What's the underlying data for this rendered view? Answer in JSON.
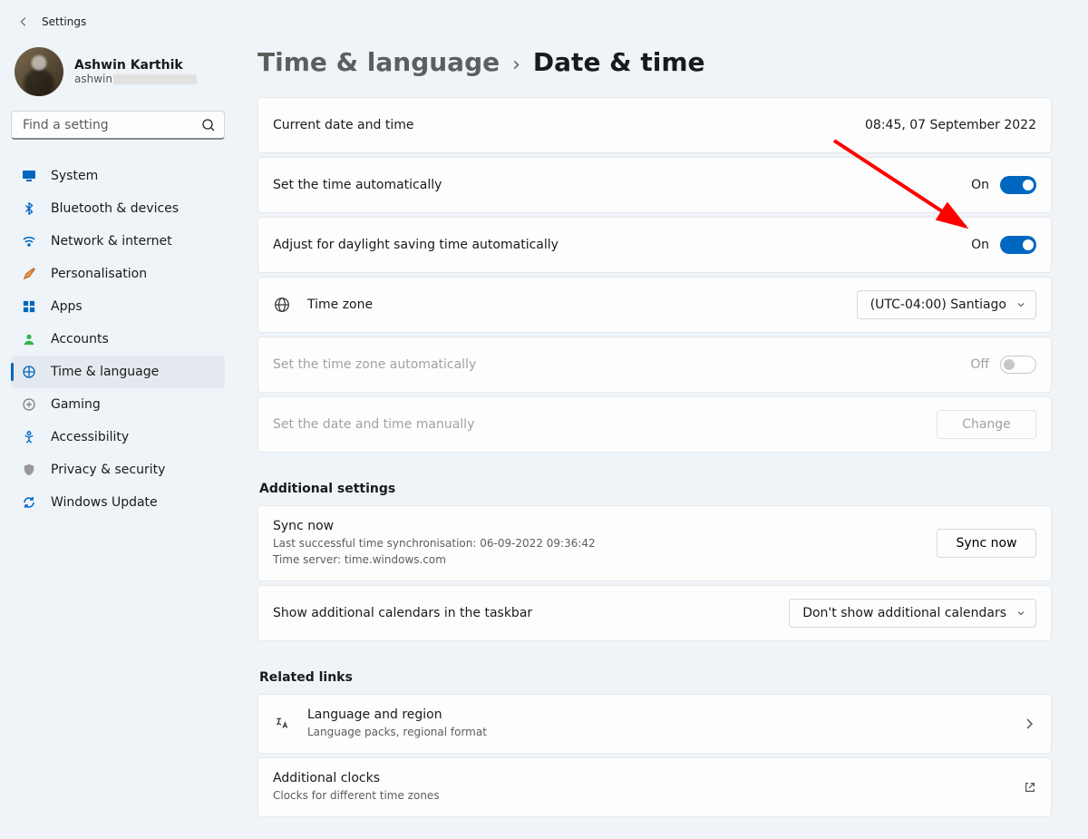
{
  "app": {
    "title": "Settings"
  },
  "user": {
    "name": "Ashwin Karthik",
    "email_prefix": "ashwin"
  },
  "search": {
    "placeholder": "Find a setting"
  },
  "nav": {
    "items": [
      {
        "label": "System"
      },
      {
        "label": "Bluetooth & devices"
      },
      {
        "label": "Network & internet"
      },
      {
        "label": "Personalisation"
      },
      {
        "label": "Apps"
      },
      {
        "label": "Accounts"
      },
      {
        "label": "Time & language"
      },
      {
        "label": "Gaming"
      },
      {
        "label": "Accessibility"
      },
      {
        "label": "Privacy & security"
      },
      {
        "label": "Windows Update"
      }
    ]
  },
  "breadcrumb": {
    "parent": "Time & language",
    "current": "Date & time"
  },
  "datetime": {
    "current_label": "Current date and time",
    "current_value": "08:45, 07 September 2022",
    "auto_time_label": "Set the time automatically",
    "auto_time_state": "On",
    "dst_label": "Adjust for daylight saving time automatically",
    "dst_state": "On",
    "timezone_label": "Time zone",
    "timezone_value": "(UTC-04:00) Santiago",
    "auto_tz_label": "Set the time zone automatically",
    "auto_tz_state": "Off",
    "manual_label": "Set the date and time manually",
    "change_btn": "Change"
  },
  "additional": {
    "title": "Additional settings",
    "sync_label": "Sync now",
    "sync_last": "Last successful time synchronisation: 06-09-2022 09:36:42",
    "sync_server": "Time server: time.windows.com",
    "sync_btn": "Sync now",
    "cal_label": "Show additional calendars in the taskbar",
    "cal_value": "Don't show additional calendars"
  },
  "related": {
    "title": "Related links",
    "lang_title": "Language and region",
    "lang_sub": "Language packs, regional format",
    "clocks_title": "Additional clocks",
    "clocks_sub": "Clocks for different time zones"
  }
}
